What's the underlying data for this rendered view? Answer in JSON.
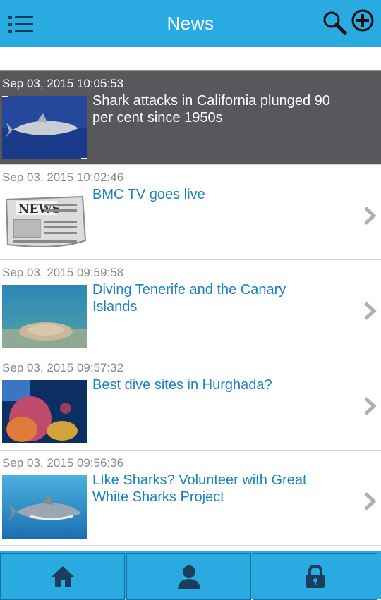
{
  "header": {
    "title": "News",
    "icons": [
      "menu-icon",
      "search-icon",
      "add-icon"
    ]
  },
  "news": [
    {
      "date": "Sep 03, 2015 10:05:53",
      "headline": "Shark attacks in California plunged 90 per cent since 1950s",
      "selected": true
    },
    {
      "date": "Sep 03, 2015 10:02:46",
      "headline": "BMC TV goes live",
      "selected": false
    },
    {
      "date": "Sep 03, 2015 09:59:58",
      "headline": "Diving Tenerife and the Canary Islands",
      "selected": false
    },
    {
      "date": "Sep 03, 2015 09:57:32",
      "headline": "Best dive sites in Hurghada?",
      "selected": false
    },
    {
      "date": "Sep 03, 2015 09:56:36",
      "headline": "LIke Sharks? Volunteer with Great White Sharks Project",
      "selected": false
    }
  ],
  "tabs": [
    "home-icon",
    "profile-icon",
    "lock-icon"
  ],
  "colors": {
    "accent": "#29abe2",
    "selected_row": "#58585c",
    "headline": "#1a82c4",
    "date": "#8a8a8a"
  }
}
